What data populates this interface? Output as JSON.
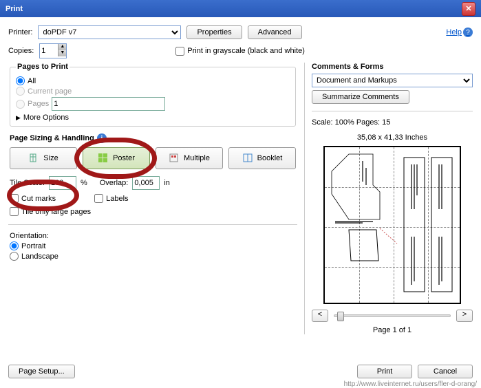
{
  "title": "Print",
  "help": "Help",
  "printer": {
    "label": "Printer:",
    "value": "doPDF v7"
  },
  "properties": "Properties",
  "advanced": "Advanced",
  "copies": {
    "label": "Copies:",
    "value": "1"
  },
  "grayscale": "Print in grayscale (black and white)",
  "pages_to_print": {
    "legend": "Pages to Print",
    "all": "All",
    "current": "Current page",
    "pages": "Pages",
    "pages_value": "1",
    "more": "More Options"
  },
  "sizing": {
    "legend": "Page Sizing & Handling",
    "size": "Size",
    "poster": "Poster",
    "multiple": "Multiple",
    "booklet": "Booklet",
    "tile_scale_l": "Tile Scale:",
    "tile_scale_v": "100",
    "pct": "%",
    "overlap_l": "Overlap:",
    "overlap_v": "0,005",
    "unit": "in",
    "cutmarks": "Cut marks",
    "labels": "Labels",
    "tile_large": "Tile only large pages"
  },
  "orientation": {
    "label": "Orientation:",
    "portrait": "Portrait",
    "landscape": "Landscape"
  },
  "comments": {
    "legend": "Comments & Forms",
    "value": "Document and Markups",
    "summarize": "Summarize Comments"
  },
  "preview": {
    "scale_pages": "Scale: 100% Pages: 15",
    "dims": "35,08 x 41,33 Inches",
    "page_of": "Page 1 of 1"
  },
  "buttons": {
    "page_setup": "Page Setup...",
    "print": "Print",
    "cancel": "Cancel"
  },
  "watermark": "http://www.liveinternet.ru/users/fler-d-orang/"
}
